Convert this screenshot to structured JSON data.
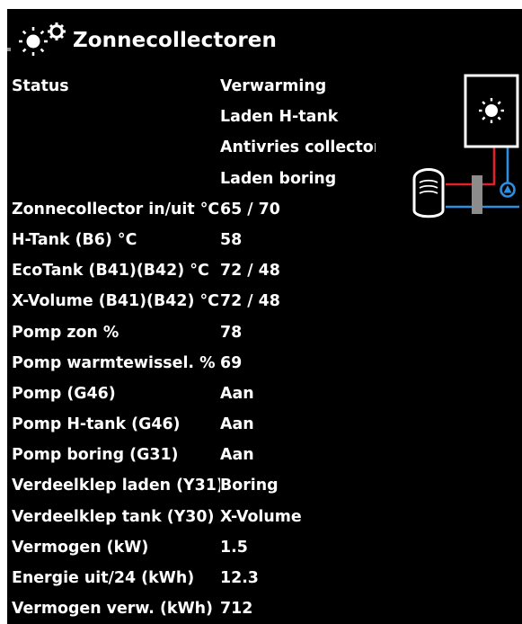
{
  "header": {
    "title": "Zonnecollectoren",
    "icon": "sun-gear-icon"
  },
  "status": {
    "label": "Status",
    "values": [
      "Verwarming",
      "Laden H-tank",
      "Antivries collector",
      "Laden boring"
    ]
  },
  "rows": [
    {
      "label": "Zonnecollector in/uit °C",
      "value": "65 / 70"
    },
    {
      "label": "H-Tank (B6) °C",
      "value": "58"
    },
    {
      "label": "EcoTank (B41)(B42) °C",
      "value": "72 / 48"
    },
    {
      "label": "X-Volume (B41)(B42) °C",
      "value": "72 / 48"
    },
    {
      "label": "Pomp zon %",
      "value": "78"
    },
    {
      "label": "Pomp warmtewissel. %",
      "value": "69"
    },
    {
      "label": "Pomp (G46)",
      "value": "Aan"
    },
    {
      "label": "Pomp H-tank (G46)",
      "value": "Aan"
    },
    {
      "label": "Pomp boring (G31)",
      "value": "Aan"
    },
    {
      "label": "Verdeelklep laden (Y31)",
      "value": "Boring"
    },
    {
      "label": "Verdeelklep tank (Y30)",
      "value": "X-Volume"
    },
    {
      "label": "Vermogen (kW)",
      "value": "1.5"
    },
    {
      "label": "Energie uit/24 (kWh)",
      "value": "12.3"
    },
    {
      "label": "Vermogen verw. (kWh)",
      "value": "712"
    }
  ],
  "diagram": {
    "icons": [
      "solar-collector-icon",
      "storage-tank-icon",
      "heat-exchanger-icon",
      "pump-icon"
    ],
    "colors": {
      "supply_line": "#e0202a",
      "return_line": "#2d8fe0",
      "exchanger": "#8c8c8c",
      "outline": "#ffffff"
    }
  },
  "colors": {
    "background": "#000000",
    "text": "#ffffff"
  }
}
